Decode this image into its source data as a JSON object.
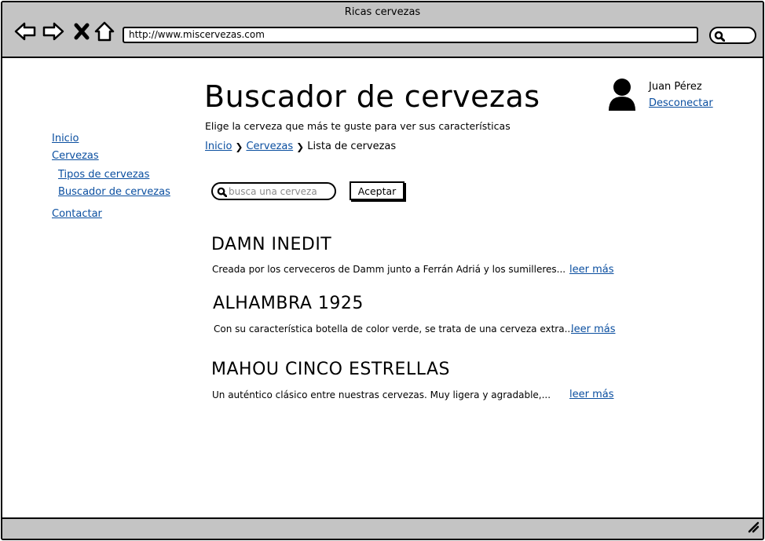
{
  "window": {
    "title": "Ricas cervezas",
    "url": "http://www.miscervezas.com"
  },
  "header": {
    "title": "Buscador de cervezas",
    "subtitle": "Elige la cerveza que más te guste para ver sus características",
    "breadcrumb": [
      "Inicio",
      "Cervezas",
      "Lista de cervezas"
    ]
  },
  "user": {
    "name": "Juan Pérez",
    "logout_label": "Desconectar"
  },
  "sidebar": {
    "items": [
      {
        "label": "Inicio"
      },
      {
        "label": "Cervezas"
      },
      {
        "label": "Tipos de cervezas"
      },
      {
        "label": "Buscador de cervezas"
      },
      {
        "label": "Contactar"
      }
    ]
  },
  "search": {
    "placeholder": "busca una cerveza",
    "button_label": "Aceptar"
  },
  "beers": [
    {
      "name": "DAMN INEDIT",
      "description": "Creada por los cerveceros de Damm junto a Ferrán Adriá y los sumilleres...",
      "more_label": "leer más"
    },
    {
      "name": "ALHAMBRA 1925",
      "description": "Con su característica botella de color verde, se trata de una cerveza extra...",
      "more_label": "leer más"
    },
    {
      "name": "MAHOU CINCO ESTRELLAS",
      "description": "Un auténtico clásico entre nuestras cervezas. Muy ligera y agradable,...",
      "more_label": "leer más"
    }
  ],
  "icons": {
    "back": "arrow-left-icon",
    "forward": "arrow-right-icon",
    "stop": "close-icon",
    "home": "home-icon",
    "search": "search-icon",
    "user": "user-icon",
    "resize": "resize-grip-icon"
  },
  "colors": {
    "link": "#0b4fa0",
    "chrome": "#c4c4c4"
  }
}
